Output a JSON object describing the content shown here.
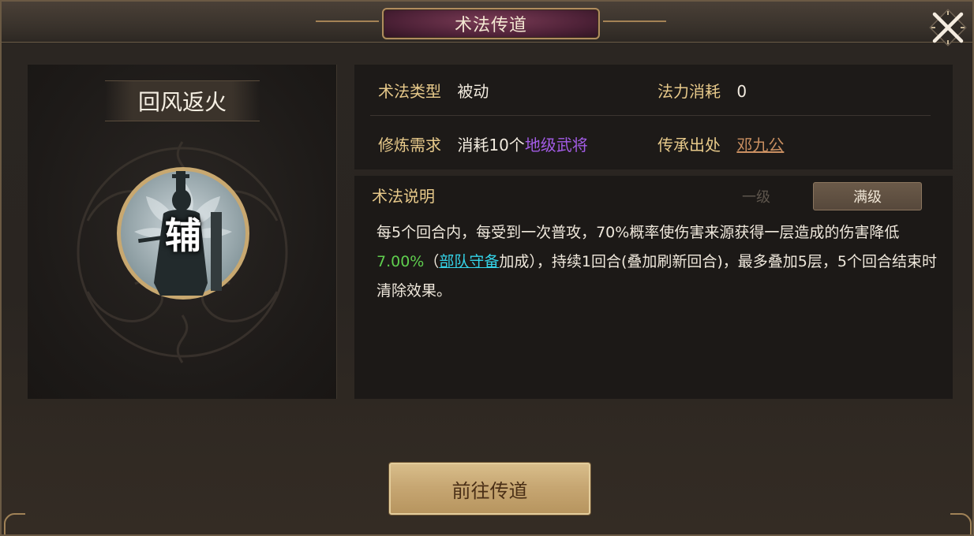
{
  "dialog": {
    "title": "术法传道",
    "close_icon": "close-icon"
  },
  "skill": {
    "name": "回风返火",
    "badge_char": "辅",
    "badge_icon": "general-silhouette-icon"
  },
  "info": {
    "type_label": "术法类型",
    "type_value": "被动",
    "mana_label": "法力消耗",
    "mana_value": "0",
    "req_label": "修炼需求",
    "req_prefix": "消耗10个",
    "req_highlight": "地级武将",
    "origin_label": "传承出处",
    "origin_value": "邓九公"
  },
  "description": {
    "title": "术法说明",
    "tabs": [
      {
        "label": "一级",
        "active": false
      },
      {
        "label": "满级",
        "active": true
      }
    ],
    "text_part1": "每5个回合内，每受到一次普攻，70%概率使伤害来源获得一层造成的伤害降低",
    "value_highlight": "7.00%",
    "text_part2": "（",
    "link_text": "部队守备",
    "text_part3": "加成），持续1回合(叠加刷新回合)，最多叠加5层，5个回合结束时清除效果。"
  },
  "actions": {
    "go_button": "前往传道"
  },
  "colors": {
    "accent_gold": "#e7c98a",
    "purple": "#a35ce6",
    "green": "#5fce4e",
    "cyan": "#34d3e8",
    "title_plate": "#5a2640"
  }
}
